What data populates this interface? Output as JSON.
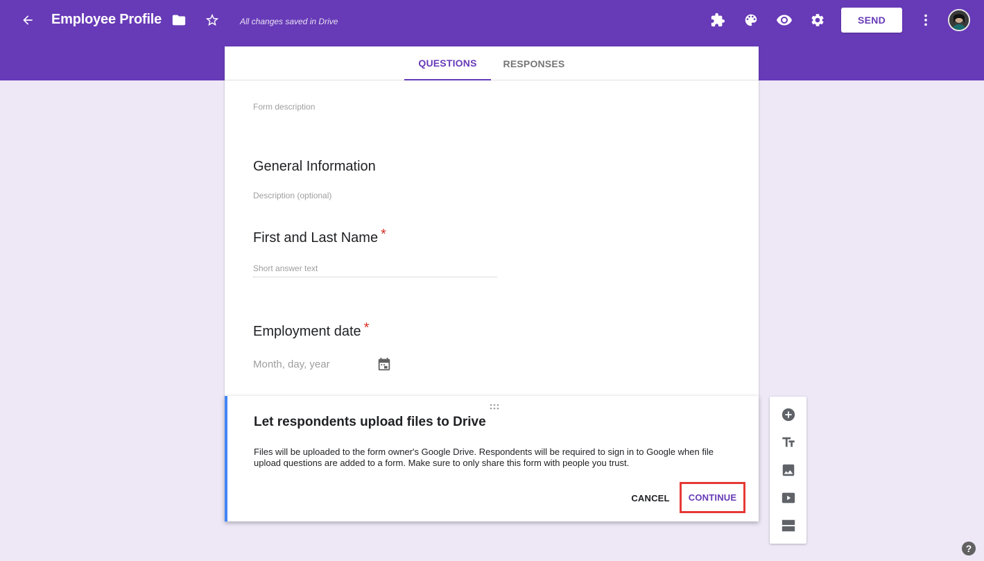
{
  "header": {
    "title": "Employee Profile",
    "saved_status": "All changes saved in Drive",
    "send_label": "SEND",
    "icons": [
      "back-arrow-icon",
      "folder-icon",
      "star-icon",
      "addons-puzzle-icon",
      "palette-icon",
      "preview-eye-icon",
      "settings-gear-icon",
      "more-vert-icon"
    ],
    "brand_color": "#673ab7"
  },
  "tabs": [
    {
      "label": "QUESTIONS",
      "active": true
    },
    {
      "label": "RESPONSES",
      "active": false
    }
  ],
  "form": {
    "description_placeholder": "Form description",
    "section_title": "General Information",
    "section_description_placeholder": "Description (optional)",
    "question1": {
      "title": "First and Last Name",
      "required_mark": "*",
      "placeholder": "Short answer text"
    },
    "question2": {
      "title": "Employment date",
      "required_mark": "*",
      "placeholder": "Month, day, year"
    }
  },
  "dialog": {
    "title": "Let respondents upload files to Drive",
    "body": "Files will be uploaded to the form owner's Google Drive. Respondents will be required to sign in to Google when file upload questions are added to a form. Make sure to only share this form with people you trust.",
    "cancel_label": "CANCEL",
    "continue_label": "CONTINUE",
    "accent_color": "#4285f4",
    "highlight_color": "#e53935"
  },
  "toolbar": {
    "items": [
      "add-question-icon",
      "add-title-icon",
      "add-image-icon",
      "add-video-icon",
      "add-section-icon"
    ]
  },
  "help_label": "?"
}
